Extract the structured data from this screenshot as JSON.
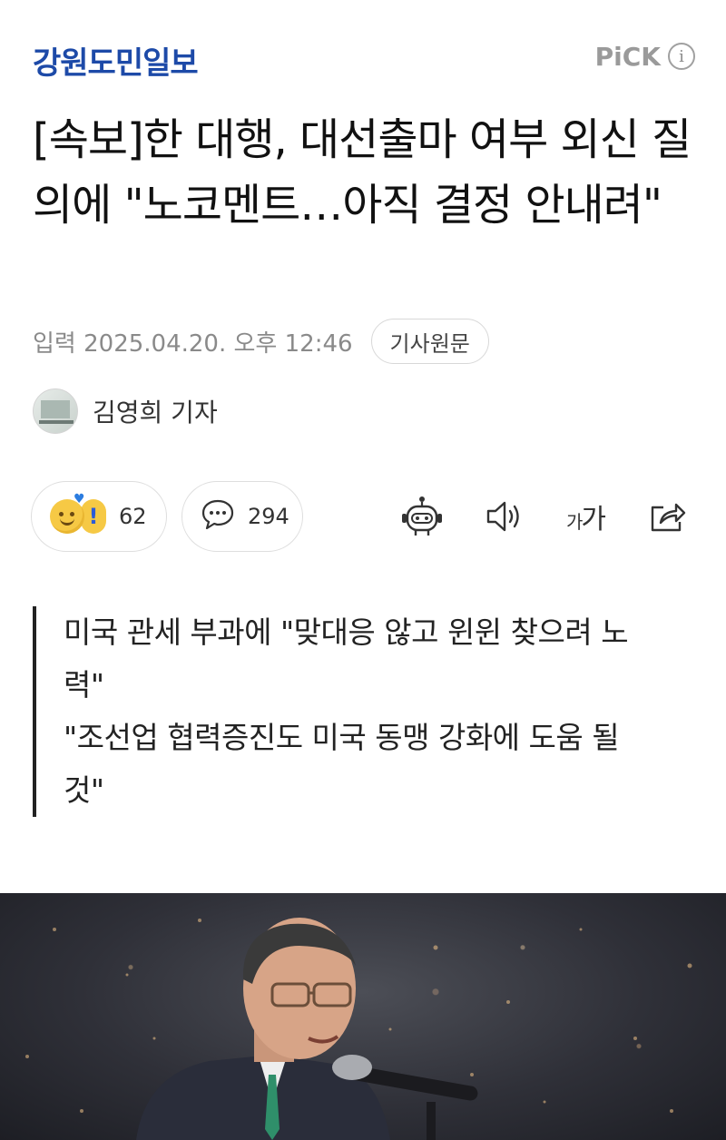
{
  "header": {
    "press_name": "강원도민일보",
    "pick_label": "PiCK",
    "info_icon_text": "i"
  },
  "article": {
    "headline": "[속보]한 대행, 대선출마 여부 외신 질의에 \"노코멘트…아직 결정 안내려\"",
    "date_text": "입력 2025.04.20. 오후 12:46",
    "original_button": "기사원문",
    "reporter": "김영희 기자",
    "summary": [
      "미국 관세 부과에 \"맞대응 않고 윈윈 찾으려 노력\"",
      "\"조선업 협력증진도 미국 동맹 강화에 도움 될 것\""
    ]
  },
  "reactions": {
    "emotion_count": "62",
    "comment_count": "294"
  },
  "tools": {
    "font_small": "가",
    "font_large": "가",
    "icons": [
      "robot-summary-icon",
      "speaker-icon",
      "font-size-icon",
      "share-icon"
    ]
  },
  "colors": {
    "brand_blue": "#1d4aa8",
    "meta_gray": "#8a8a8a",
    "emoji_yellow": "#f6c945"
  }
}
